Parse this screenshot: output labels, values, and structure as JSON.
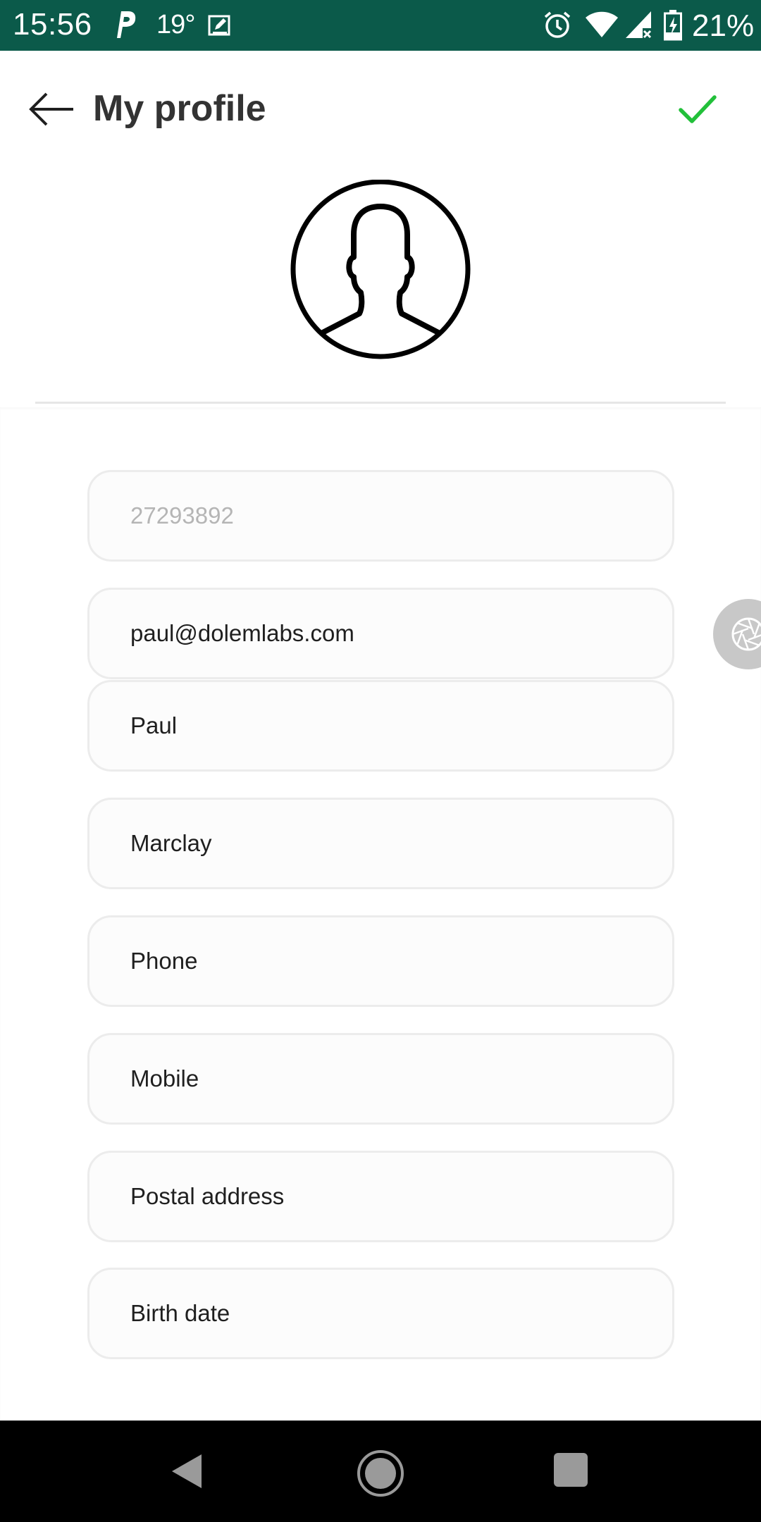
{
  "status_bar": {
    "time": "15:56",
    "temperature": "19°",
    "battery_percent": "21%",
    "icons": [
      "parking-icon",
      "edit-icon",
      "alarm-icon",
      "wifi-icon",
      "cell-signal-icon",
      "battery-charging-icon"
    ],
    "background_color": "#0b5a4a"
  },
  "app_bar": {
    "title": "My profile",
    "back_icon": "arrow-left-icon",
    "save_icon": "checkmark-icon",
    "save_color": "#22c03a"
  },
  "profile": {
    "avatar_icon": "user-avatar-icon"
  },
  "form": {
    "id_value": "27293892",
    "email_value": "paul@dolemlabs.com",
    "first_name_value": "Paul",
    "last_name_value": "Marclay",
    "phone_placeholder": "Phone",
    "mobile_placeholder": "Mobile",
    "postal_address_placeholder": "Postal address",
    "birth_date_placeholder": "Birth date"
  },
  "floating_button": {
    "icon": "camera-shutter-icon"
  },
  "nav_bar": {
    "icons": [
      "nav-back-icon",
      "nav-home-icon",
      "nav-recents-icon"
    ]
  }
}
